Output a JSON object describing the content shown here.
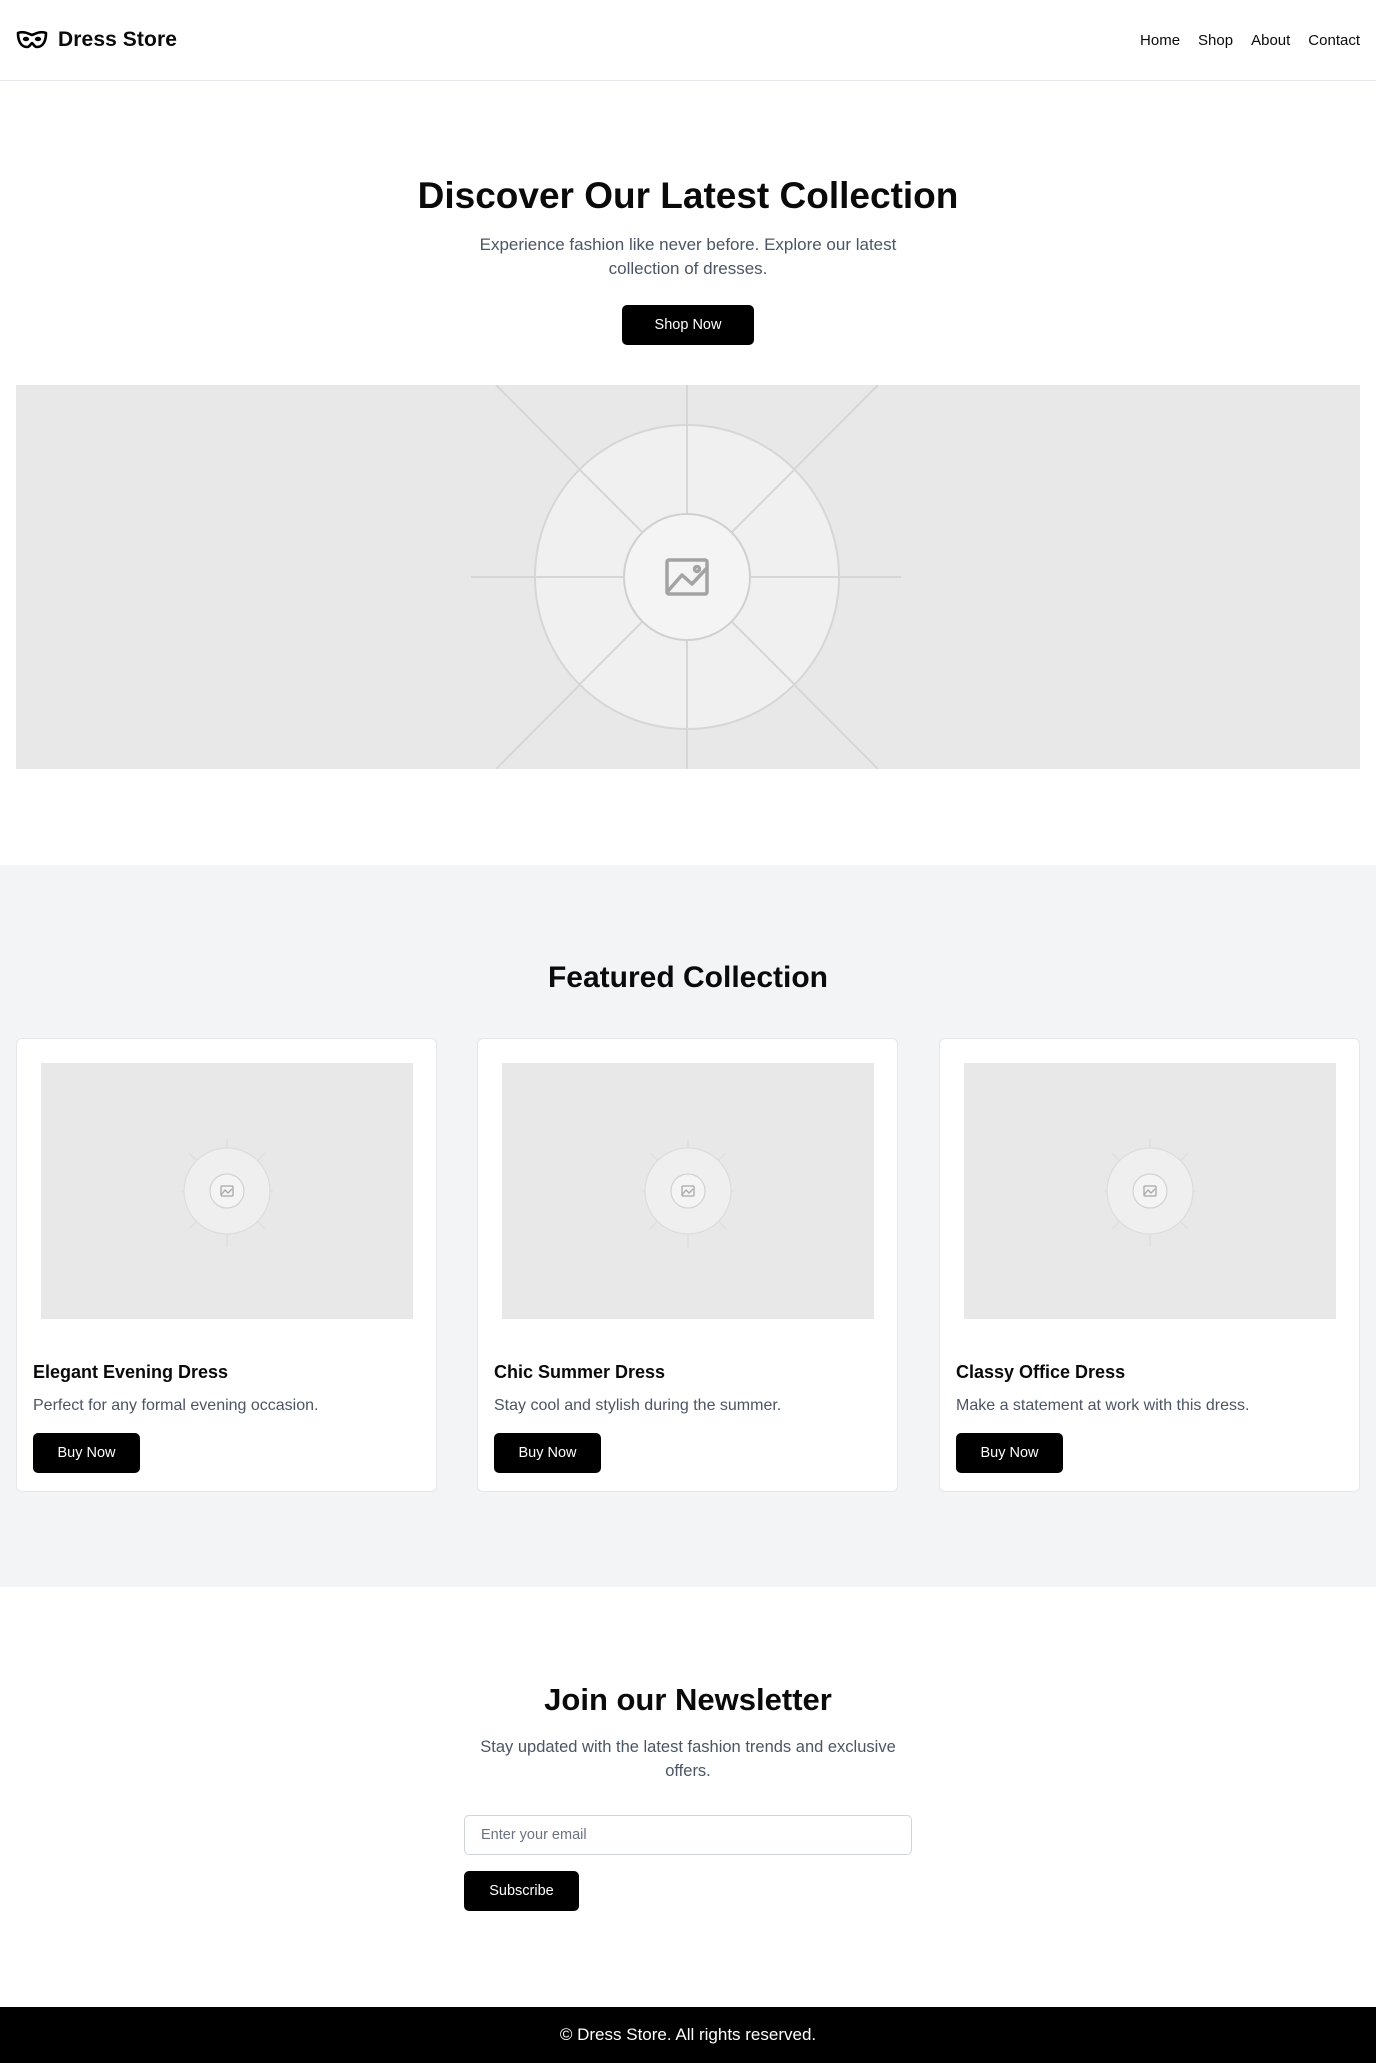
{
  "header": {
    "brand": "Dress Store",
    "logo_icon": "mask-icon",
    "nav": [
      "Home",
      "Shop",
      "About",
      "Contact"
    ]
  },
  "hero": {
    "title": "Discover Our Latest Collection",
    "subtitle": "Experience fashion like never before. Explore our latest collection of dresses.",
    "cta": "Shop Now",
    "image_icon": "image-placeholder-icon"
  },
  "featured": {
    "title": "Featured Collection",
    "products": [
      {
        "name": "Elegant Evening Dress",
        "description": "Perfect for any formal evening occasion.",
        "button": "Buy Now"
      },
      {
        "name": "Chic Summer Dress",
        "description": "Stay cool and stylish during the summer.",
        "button": "Buy Now"
      },
      {
        "name": "Classy Office Dress",
        "description": "Make a statement at work with this dress.",
        "button": "Buy Now"
      }
    ]
  },
  "newsletter": {
    "title": "Join our Newsletter",
    "subtitle": "Stay updated with the latest fashion trends and exclusive offers.",
    "email_placeholder": "Enter your email",
    "email_value": "",
    "button": "Subscribe"
  },
  "footer": {
    "copyright": "© Dress Store. All rights reserved."
  },
  "colors": {
    "primary": "#000000",
    "section_bg": "#f3f4f6",
    "muted_text": "#4b5563",
    "placeholder_bg": "#e8e8e8"
  }
}
